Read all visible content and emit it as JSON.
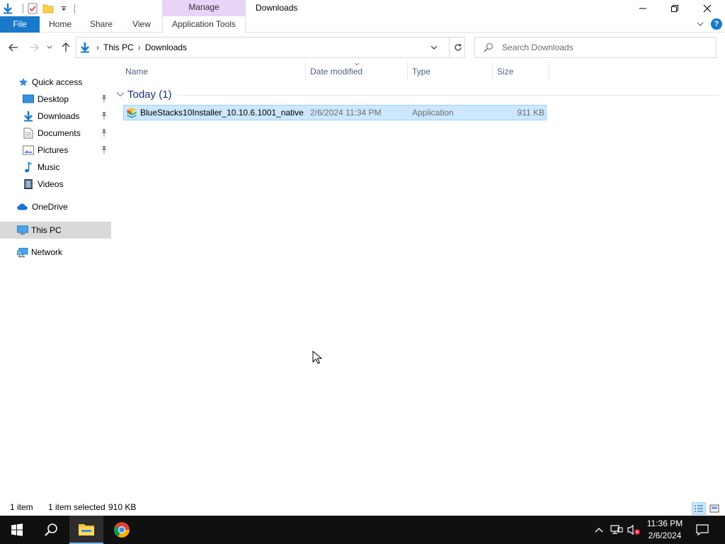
{
  "window": {
    "title": "Downloads",
    "contextual_group": "Manage",
    "minimize_label": "—",
    "restore_label": "❐",
    "close_label": "✕"
  },
  "ribbon": {
    "tabs": [
      "File",
      "Home",
      "Share",
      "View",
      "Application Tools"
    ],
    "help": "?"
  },
  "address": {
    "crumbs": [
      "This PC",
      "Downloads"
    ],
    "separator": "›"
  },
  "search": {
    "placeholder": "Search Downloads"
  },
  "nav_pane": {
    "items": [
      {
        "label": "Quick access",
        "icon": "star-icon"
      },
      {
        "label": "Desktop",
        "icon": "desktop-icon",
        "pinned": true
      },
      {
        "label": "Downloads",
        "icon": "downloads-icon",
        "pinned": true
      },
      {
        "label": "Documents",
        "icon": "documents-icon",
        "pinned": true
      },
      {
        "label": "Pictures",
        "icon": "pictures-icon",
        "pinned": true
      },
      {
        "label": "Music",
        "icon": "music-icon"
      },
      {
        "label": "Videos",
        "icon": "videos-icon"
      },
      {
        "label": "OneDrive",
        "icon": "onedrive-icon"
      },
      {
        "label": "This PC",
        "icon": "this-pc-icon",
        "selected": true
      },
      {
        "label": "Network",
        "icon": "network-icon"
      }
    ]
  },
  "file_list": {
    "columns": [
      "Name",
      "Date modified",
      "Type",
      "Size"
    ],
    "group": "Today (1)",
    "rows": [
      {
        "name": "BlueStacks10Installer_10.10.6.1001_native...",
        "date_modified": "2/6/2024 11:34 PM",
        "type": "Application",
        "size": "911 KB",
        "selected": true
      }
    ]
  },
  "status_bar": {
    "item_count": "1 item",
    "selection": "1 item selected",
    "selection_size": "910 KB"
  },
  "taskbar": {
    "time": "11:36 PM",
    "date": "2/6/2024"
  },
  "colors": {
    "accent": "#1979ca",
    "selection_fill": "#cce8ff",
    "selection_border": "#99d1ff",
    "contextual_tab": "#e8d4f7",
    "group_header": "#1e3287",
    "taskbar": "#101010"
  }
}
